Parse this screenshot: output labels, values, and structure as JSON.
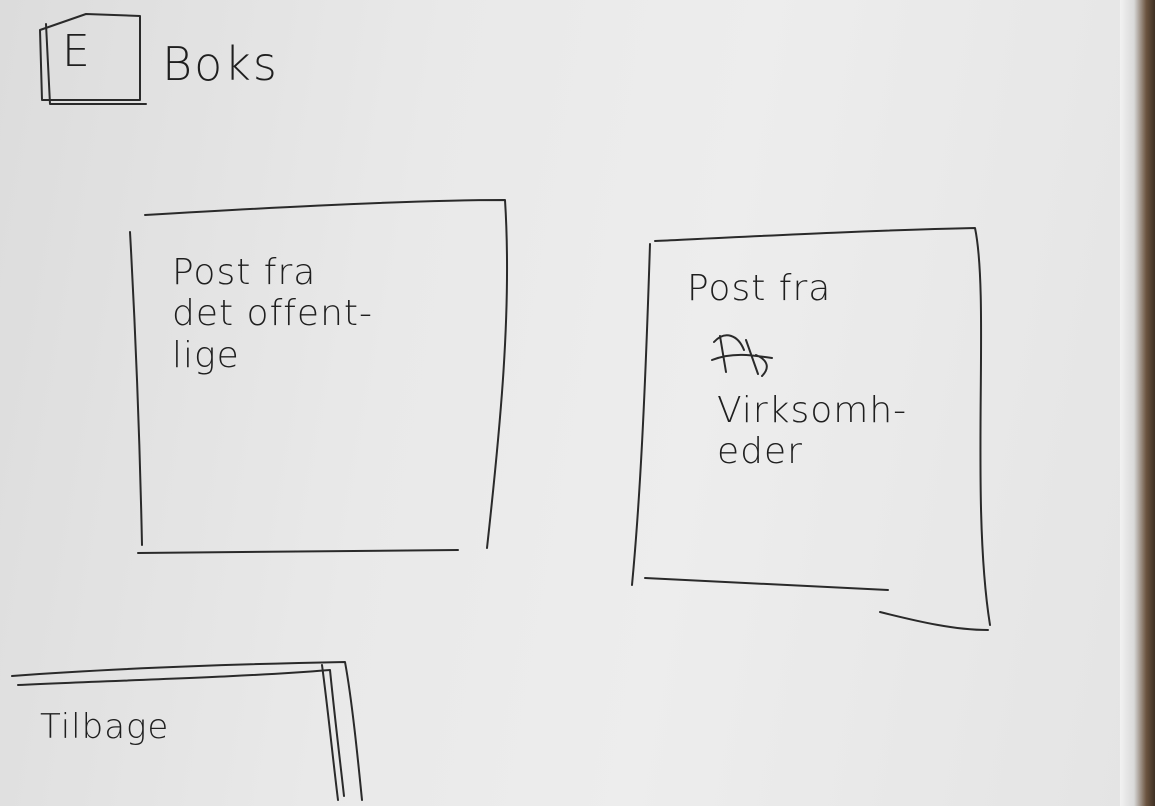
{
  "header": {
    "logo_letter": "E",
    "logo_word": "Boks"
  },
  "cards": [
    {
      "label": "Post fra\ndet offent-\nlige"
    },
    {
      "label_top": "Post fra",
      "label_bottom": "Virksomh-\neder"
    }
  ],
  "footer": {
    "back_label": "Tilbage"
  }
}
